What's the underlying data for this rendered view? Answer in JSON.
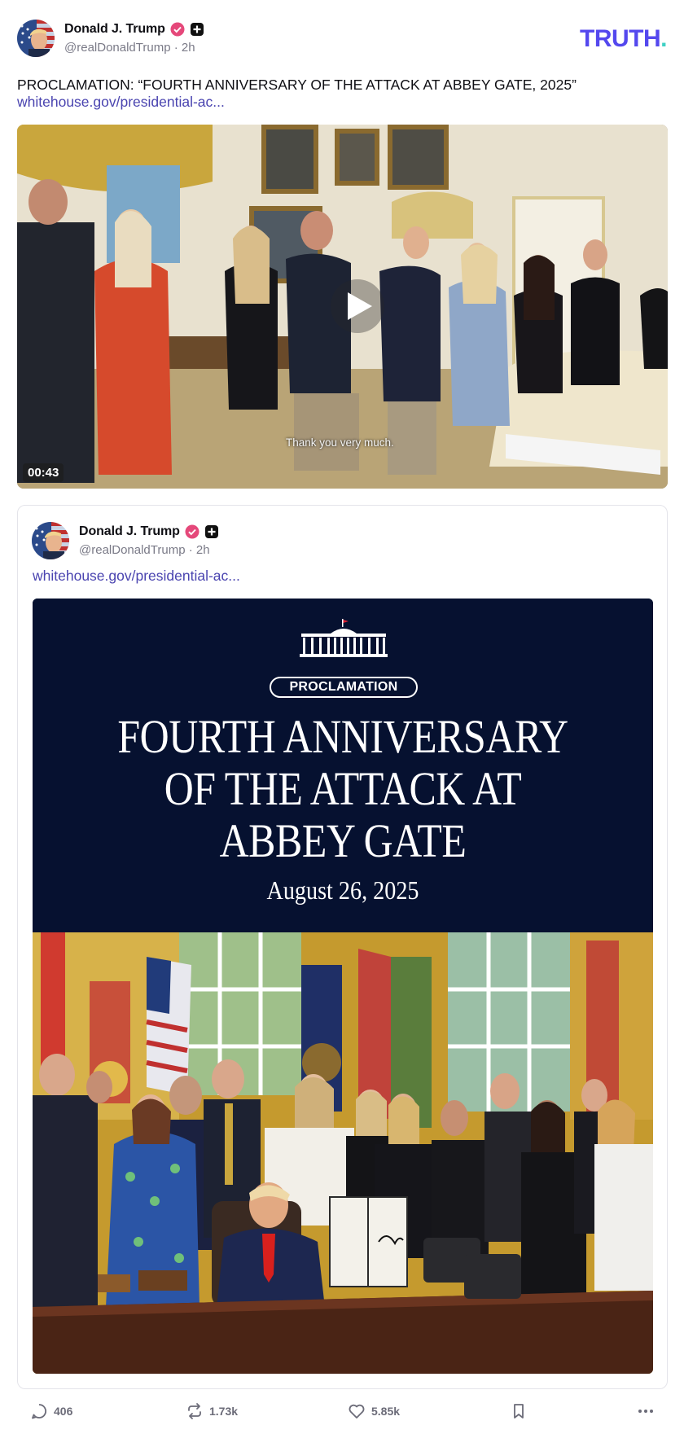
{
  "post": {
    "author_name": "Donald J. Trump",
    "handle": "@realDonaldTrump",
    "separator": "·",
    "time": "2h",
    "text": "PROCLAMATION: “FOURTH ANNIVERSARY OF THE ATTACK AT ABBEY GATE, 2025”",
    "link": "whitehouse.gov/presidential-ac...",
    "verified_badge_color": "#e5487a"
  },
  "app": {
    "logo_text": "TRUTH",
    "logo_dot": ".",
    "logo_color": "#5448ee",
    "logo_dot_color": "#3fd1c4"
  },
  "video": {
    "duration": "00:43",
    "caption": "Thank you very much.",
    "icon": "play-icon"
  },
  "quote": {
    "author_name": "Donald J. Trump",
    "handle": "@realDonaldTrump",
    "separator": "·",
    "time": "2h",
    "link": "whitehouse.gov/presidential-ac...",
    "image": {
      "pill": "PROCLAMATION",
      "title_lines": [
        "FOURTH ANNIVERSARY",
        "OF THE ATTACK AT",
        "ABBEY GATE"
      ],
      "date": "August 26, 2025",
      "banner_color": "#061130"
    }
  },
  "actions": {
    "replies": "406",
    "reposts": "1.73k",
    "likes": "5.85k",
    "icons": [
      "comment-icon",
      "repost-icon",
      "heart-icon",
      "bookmark-icon",
      "more-icon"
    ]
  }
}
